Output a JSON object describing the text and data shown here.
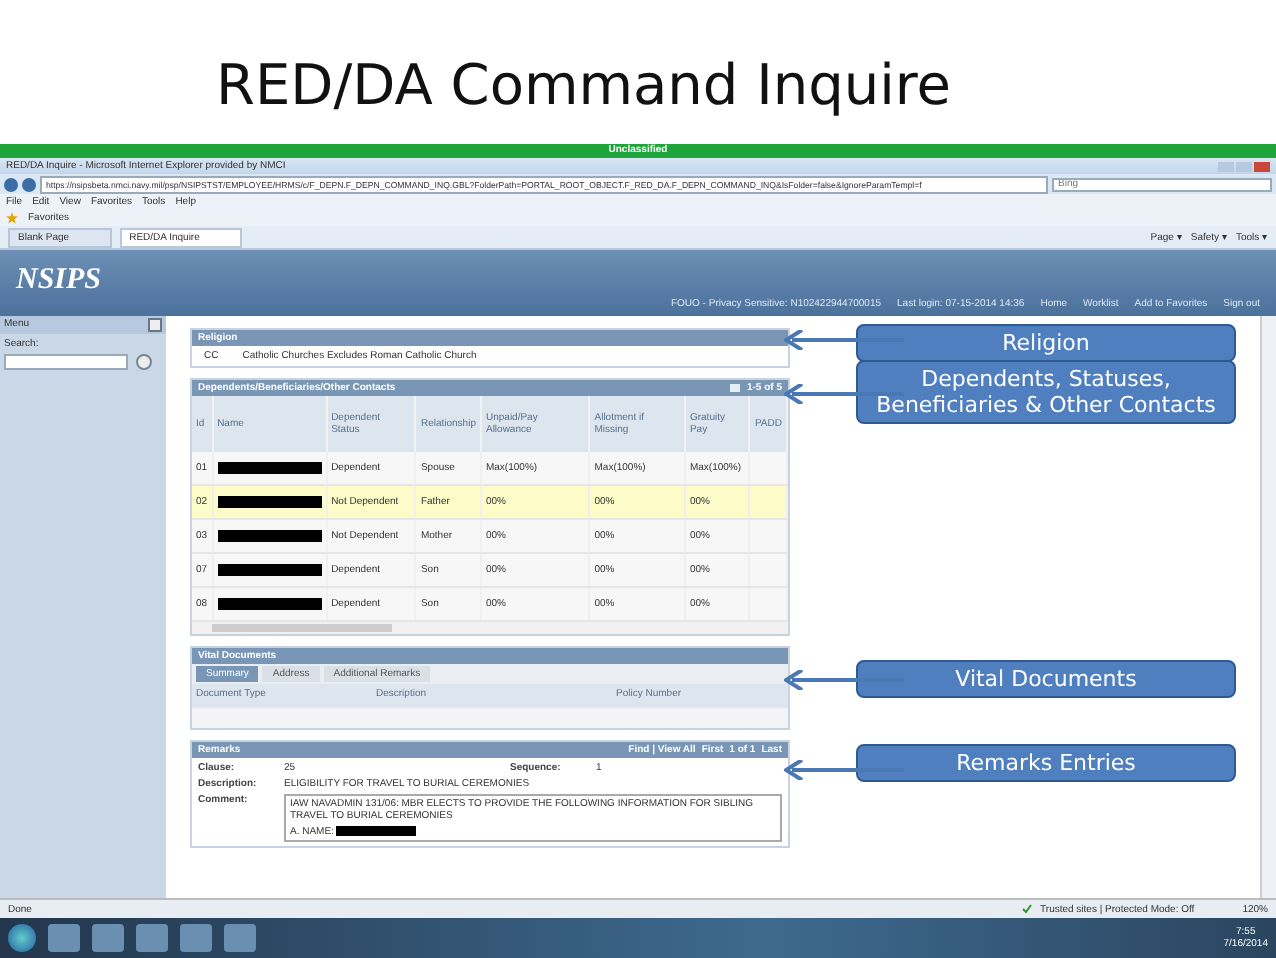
{
  "slide_title": "RED/DA Command Inquire",
  "classification": "Unclassified",
  "browser": {
    "title": "RED/DA Inquire - Microsoft Internet Explorer provided by NMCI",
    "address": "https://nsipsbeta.nmci.navy.mil/psp/NSIPSTST/EMPLOYEE/HRMS/c/F_DEPN.F_DEPN_COMMAND_INQ.GBL?FolderPath=PORTAL_ROOT_OBJECT.F_RED_DA.F_DEPN_COMMAND_INQ&IsFolder=false&IgnoreParamTempl=f",
    "search_placeholder": "Bing",
    "menu": [
      "File",
      "Edit",
      "View",
      "Favorites",
      "Tools",
      "Help"
    ],
    "favorites": "Favorites",
    "tabs": [
      {
        "label": "Blank Page",
        "selected": false
      },
      {
        "label": "RED/DA Inquire",
        "selected": true
      }
    ],
    "commands": [
      "Page ▾",
      "Safety ▾",
      "Tools ▾"
    ]
  },
  "app": {
    "logo": "NSIPS",
    "links": [
      "FOUO - Privacy Sensitive: N102422944700015",
      "Last login: 07-15-2014 14:36",
      "Home",
      "Worklist",
      "Add to Favorites",
      "Sign out"
    ],
    "menu_title": "Menu",
    "search_label": "Search:"
  },
  "religion": {
    "title": "Religion",
    "code": "CC",
    "name": "Catholic Churches Excludes Roman Catholic Church"
  },
  "dependents": {
    "title": "Dependents/Beneficiaries/Other Contacts",
    "count": "1-5 of 5",
    "columns": [
      "Id",
      "Name",
      "Dependent Status",
      "Relationship",
      "Unpaid/Pay Allowance",
      "Allotment if Missing",
      "Gratuity Pay",
      "PADD"
    ],
    "rows": [
      {
        "id": "01",
        "redacted": true,
        "status": "Dependent",
        "relationship": "Spouse",
        "allowance": "Max(100%)",
        "allotment": "Max(100%)",
        "gratuity": "Max(100%)",
        "selected": false
      },
      {
        "id": "02",
        "redacted": true,
        "status": "Not Dependent",
        "relationship": "Father",
        "allowance": "00%",
        "allotment": "00%",
        "gratuity": "00%",
        "selected": true
      },
      {
        "id": "03",
        "redacted": true,
        "status": "Not Dependent",
        "relationship": "Mother",
        "allowance": "00%",
        "allotment": "00%",
        "gratuity": "00%",
        "selected": false
      },
      {
        "id": "07",
        "redacted": true,
        "status": "Dependent",
        "relationship": "Son",
        "allowance": "00%",
        "allotment": "00%",
        "gratuity": "00%",
        "selected": false
      },
      {
        "id": "08",
        "redacted": true,
        "status": "Dependent",
        "relationship": "Son",
        "allowance": "00%",
        "allotment": "00%",
        "gratuity": "00%",
        "selected": false
      }
    ]
  },
  "vital_documents": {
    "title": "Vital Documents",
    "tabs": [
      {
        "label": "Summary",
        "selected": true
      },
      {
        "label": "Address",
        "selected": false
      },
      {
        "label": "Additional Remarks",
        "selected": false
      }
    ],
    "columns": [
      "Document Type",
      "Description",
      "Policy Number"
    ]
  },
  "remarks": {
    "title": "Remarks",
    "find": "Find | View All",
    "first": "First",
    "count": "1 of 1",
    "last": "Last",
    "clause_label": "Clause:",
    "clause": "25",
    "sequence_label": "Sequence:",
    "sequence": "1",
    "description_label": "Description:",
    "description": "ELIGIBILITY FOR TRAVEL TO BURIAL CEREMONIES",
    "comment_label": "Comment:",
    "comment": "IAW NAVADMIN 131/06: MBR ELECTS TO PROVIDE THE FOLLOWING INFORMATION FOR SIBLING TRAVEL TO BURIAL CEREMONIES",
    "comment_name_label": "A. NAME:",
    "comment_name_redacted": true
  },
  "status_bar": {
    "left": "Done",
    "zone": "Trusted sites | Protected Mode: Off",
    "zoom": "120%"
  },
  "taskbar": {
    "time": "7:55",
    "date": "7/16/2014"
  },
  "callouts": [
    "Religion",
    "Dependents, Statuses, Beneficiaries & Other Contacts",
    "Vital Documents",
    "Remarks Entries"
  ]
}
